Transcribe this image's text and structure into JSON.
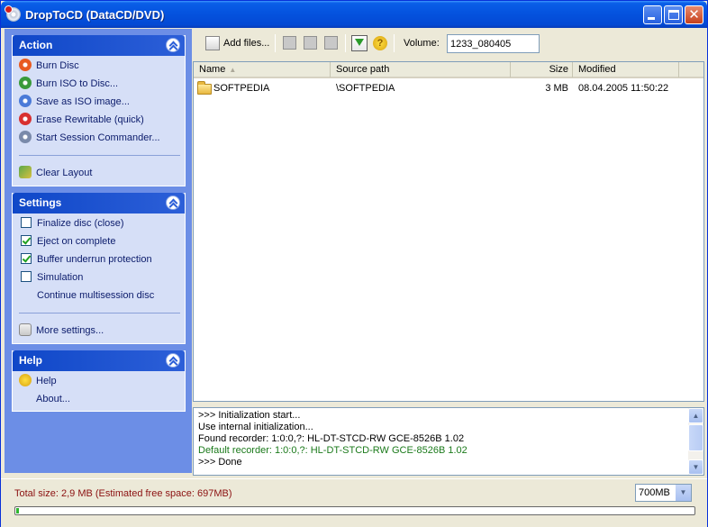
{
  "window": {
    "title": "DropToCD (DataCD/DVD)"
  },
  "action_group": {
    "title": "Action",
    "items": [
      {
        "label": "Burn Disc",
        "color": "#E85A20"
      },
      {
        "label": "Burn ISO to Disc...",
        "color": "#3A9A3A"
      },
      {
        "label": "Save as ISO image...",
        "color": "#4A7AD8"
      },
      {
        "label": "Erase Rewritable (quick)",
        "color": "#D83030"
      },
      {
        "label": "Start Session Commander...",
        "color": "#7A8AAA"
      }
    ],
    "clear_layout": "Clear Layout"
  },
  "settings_group": {
    "title": "Settings",
    "options": [
      {
        "label": "Finalize disc (close)",
        "checked": false,
        "has_checkbox": true
      },
      {
        "label": "Eject on complete",
        "checked": true,
        "has_checkbox": true
      },
      {
        "label": "Buffer underrun protection",
        "checked": true,
        "has_checkbox": true
      },
      {
        "label": "Simulation",
        "checked": false,
        "has_checkbox": true
      },
      {
        "label": "Continue multisession disc",
        "checked": false,
        "has_checkbox": false
      }
    ],
    "more_settings": "More settings..."
  },
  "help_group": {
    "title": "Help",
    "items": [
      "Help",
      "About..."
    ]
  },
  "toolbar": {
    "add_files_label": "Add files...",
    "volume_label": "Volume:",
    "volume_value": "1233_080405"
  },
  "file_list": {
    "columns": [
      "Name",
      "Source path",
      "Size",
      "Modified"
    ],
    "rows": [
      {
        "name": "SOFTPEDIA",
        "source": "\\SOFTPEDIA",
        "size": "3 MB",
        "modified": "08.04.2005 11:50:22"
      }
    ]
  },
  "log": {
    "lines": [
      {
        "text": ">>> Initialization start...",
        "green": false
      },
      {
        "text": "Use internal initialization...",
        "green": false
      },
      {
        "text": "Found recorder: 1:0:0,?: HL-DT-STCD-RW GCE-8526B 1.02",
        "green": false
      },
      {
        "text": "Default recorder: 1:0:0,?: HL-DT-STCD-RW GCE-8526B 1.02",
        "green": true
      },
      {
        "text": ">>> Done",
        "green": false
      }
    ]
  },
  "status": {
    "total_size": "Total size: 2,9 MB (Estimated free space: 697MB)",
    "disc_size": "700MB",
    "progress_fraction": 0.004
  }
}
